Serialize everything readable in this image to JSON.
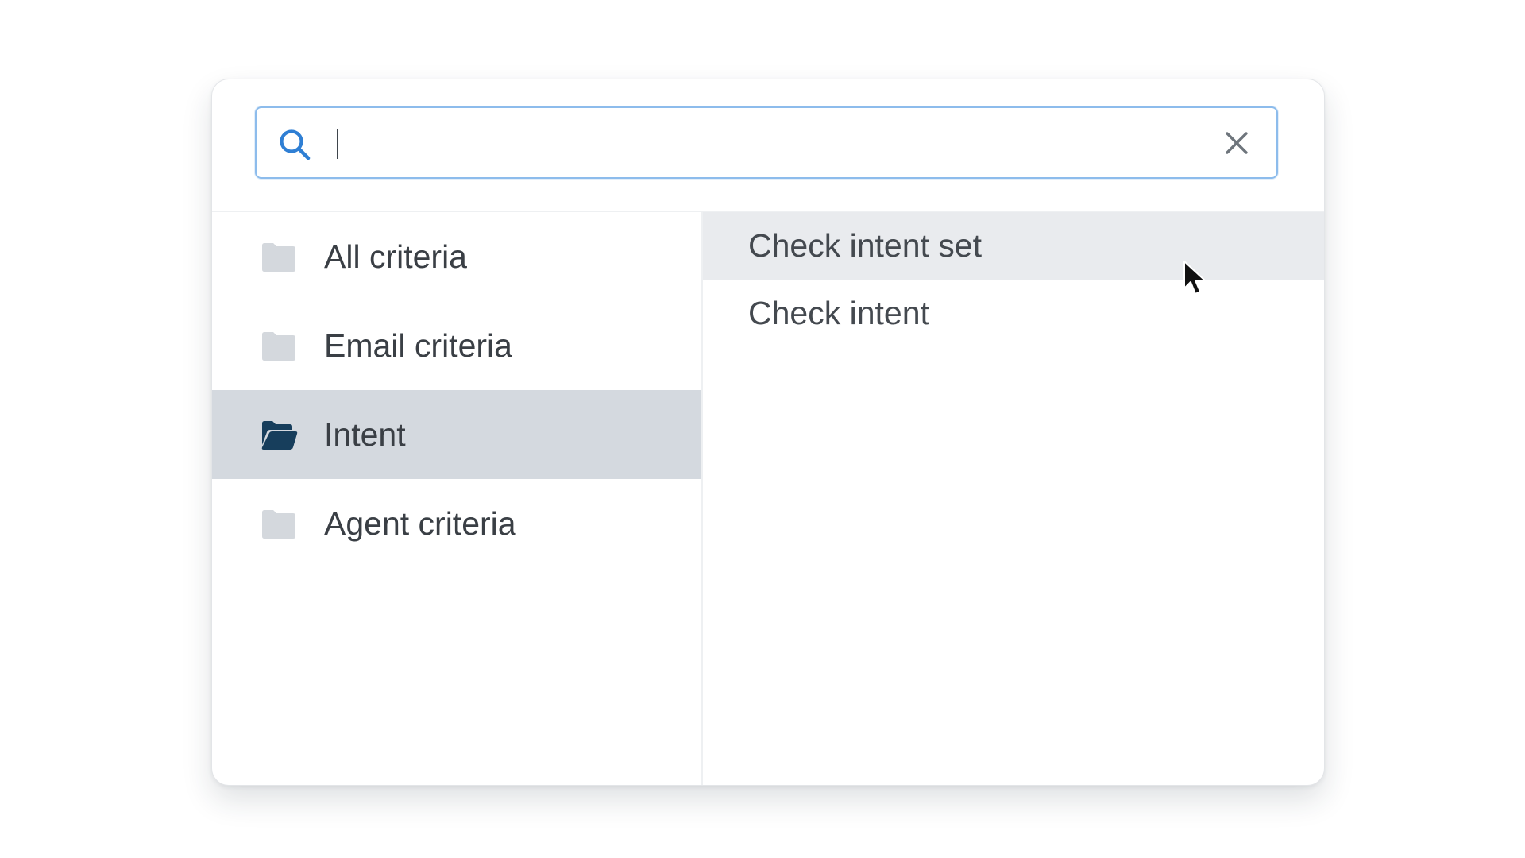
{
  "search": {
    "value": "",
    "placeholder": "",
    "icon": "search-icon",
    "clear_icon": "close-icon",
    "accent_color": "#2f7fd4",
    "border_color": "#8dbcec"
  },
  "categories": [
    {
      "label": "All criteria",
      "icon": "folder-icon",
      "selected": false
    },
    {
      "label": "Email criteria",
      "icon": "folder-icon",
      "selected": false
    },
    {
      "label": "Intent",
      "icon": "folder-open-icon",
      "selected": true
    },
    {
      "label": "Agent criteria",
      "icon": "folder-icon",
      "selected": false
    }
  ],
  "results": [
    {
      "label": "Check intent set",
      "hovered": true
    },
    {
      "label": "Check intent",
      "hovered": false
    }
  ],
  "colors": {
    "selected_category_bg": "#d4d9df",
    "hovered_result_bg": "#e9ebee",
    "folder_muted": "#d4d8dd",
    "folder_active": "#173e5c",
    "text": "#3a3f45"
  }
}
